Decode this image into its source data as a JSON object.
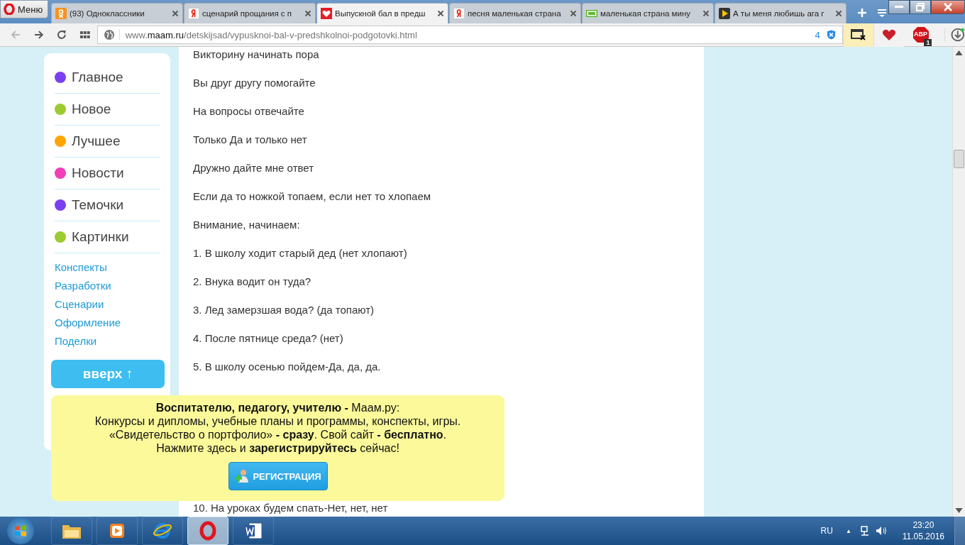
{
  "browser": {
    "menu_label": "Меню",
    "tabs": [
      {
        "title": "(93) Одноклассники",
        "kind": "ok",
        "selected": false
      },
      {
        "title": "сценарий прощания с п",
        "kind": "yandex",
        "selected": false
      },
      {
        "title": "Выпускной бал в предш",
        "kind": "heart",
        "selected": true
      },
      {
        "title": "песня маленькая страна",
        "kind": "yandex",
        "selected": false
      },
      {
        "title": "маленькая страна мину",
        "kind": "mp3",
        "selected": false
      },
      {
        "title": "А ты меня любишь ага г",
        "kind": "play",
        "selected": false
      }
    ],
    "back_disabled": true,
    "url": {
      "prefix": "www.",
      "domain": "maam.ru",
      "path": "/detskijsad/vypusknoi-bal-v-predshkolnoi-podgotovki.html"
    },
    "blocked_count": "4",
    "abp_label": "ABP",
    "abp_badge": "1"
  },
  "sidebar": {
    "main_items": [
      {
        "label": "Главное",
        "color": "#7b3ff2"
      },
      {
        "label": "Новое",
        "color": "#9ccb30"
      },
      {
        "label": "Лучшее",
        "color": "#ffa500"
      },
      {
        "label": "Новости",
        "color": "#f23fb8"
      },
      {
        "label": "Темочки",
        "color": "#7b3ff2"
      },
      {
        "label": "Картинки",
        "color": "#9ccb30"
      }
    ],
    "links": [
      "Конспекты",
      "Разработки",
      "Сценарии",
      "Оформление",
      "Поделки"
    ]
  },
  "article_lines": [
    "Викторину начинать пора",
    "Вы друг другу помогайте",
    "На вопросы отвечайте",
    "Только Да и только нет",
    "Дружно дайте мне ответ",
    "Если да то ножкой топаем, если нет то хлопаем",
    "Внимание, начинаем:",
    "1. В школу ходит старый дед (нет хлопают)",
    "2. Внука водит он туда?",
    "3. Лед замерзшая вода? (да топают)",
    "4. После пятнице среда? (нет)",
    "5. В школу осенью пойдем-Да, да, да."
  ],
  "article_last_line": "10. На уроках будем спать-Нет, нет, нет",
  "scroll_top_button": "вверх ↑",
  "promo": {
    "lines": [
      "**Воспитателю, педагогу, учителю -** Маам.ру:",
      "Конкурсы и дипломы, учебные планы и программы, конспекты, игры.",
      "«Свидетельство о портфолио» **- сразу**. Свой сайт **- бесплатно**.",
      "Нажмите здесь и **зарегистрируйтесь** сейчас!"
    ],
    "button": "РЕГИСТРАЦИЯ"
  },
  "taskbar": {
    "apps": [
      {
        "kind": "folder",
        "active": false
      },
      {
        "kind": "media",
        "active": false
      },
      {
        "kind": "ie",
        "active": false
      },
      {
        "kind": "opera",
        "active": true
      },
      {
        "kind": "word",
        "active": false
      }
    ],
    "language": "RU",
    "tray_arrow": "▲",
    "time": "23:20",
    "date": "11.05.2016"
  }
}
